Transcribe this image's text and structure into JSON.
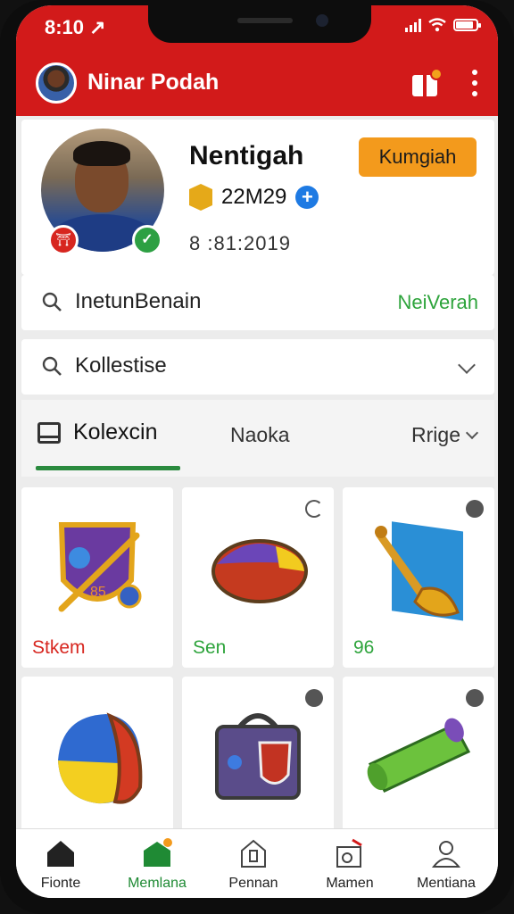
{
  "status": {
    "time": "8:10 ↗",
    "battery_percent": 85
  },
  "appbar": {
    "user_name": "Ninar Podah",
    "gift_icon": "gift-icon",
    "menu_icon": "more-vertical-icon"
  },
  "profile": {
    "name": "Nentigah",
    "coins": "22M29",
    "date": "8 :81:2019",
    "action_label": "Kumgiah",
    "badge_left_icon": "shield-icon",
    "badge_right_icon": "check-icon"
  },
  "search": {
    "text": "InetunBenain",
    "link_label": "NeiVerah"
  },
  "collection_select": {
    "text": "Kollestise"
  },
  "tabs": {
    "active_label": "Kolexcin",
    "second_label": "Naoka",
    "filter_label": "Rrige"
  },
  "items": [
    {
      "label": "Stkem",
      "label_color": "#d7261f",
      "icon": "crest-icon"
    },
    {
      "label": "Sen",
      "label_color": "#2ea43c",
      "icon": "ball-icon"
    },
    {
      "label": "96",
      "label_color": "#2ea43c",
      "icon": "trumpet-icon"
    },
    {
      "label": "",
      "label_color": "#222",
      "icon": "helmet-icon"
    },
    {
      "label": "",
      "label_color": "#222",
      "icon": "chest-icon"
    },
    {
      "label": "",
      "label_color": "#222",
      "icon": "cash-roll-icon"
    }
  ],
  "nav": [
    {
      "label": "Fionte",
      "icon": "home-icon"
    },
    {
      "label": "Memlana",
      "icon": "store-icon"
    },
    {
      "label": "Pennan",
      "icon": "building-icon"
    },
    {
      "label": "Mamen",
      "icon": "box-icon"
    },
    {
      "label": "Mentiana",
      "icon": "person-icon"
    }
  ],
  "colors": {
    "brand": "#d21a1a",
    "accent_orange": "#f39a1c",
    "accent_green": "#2ea43c"
  }
}
